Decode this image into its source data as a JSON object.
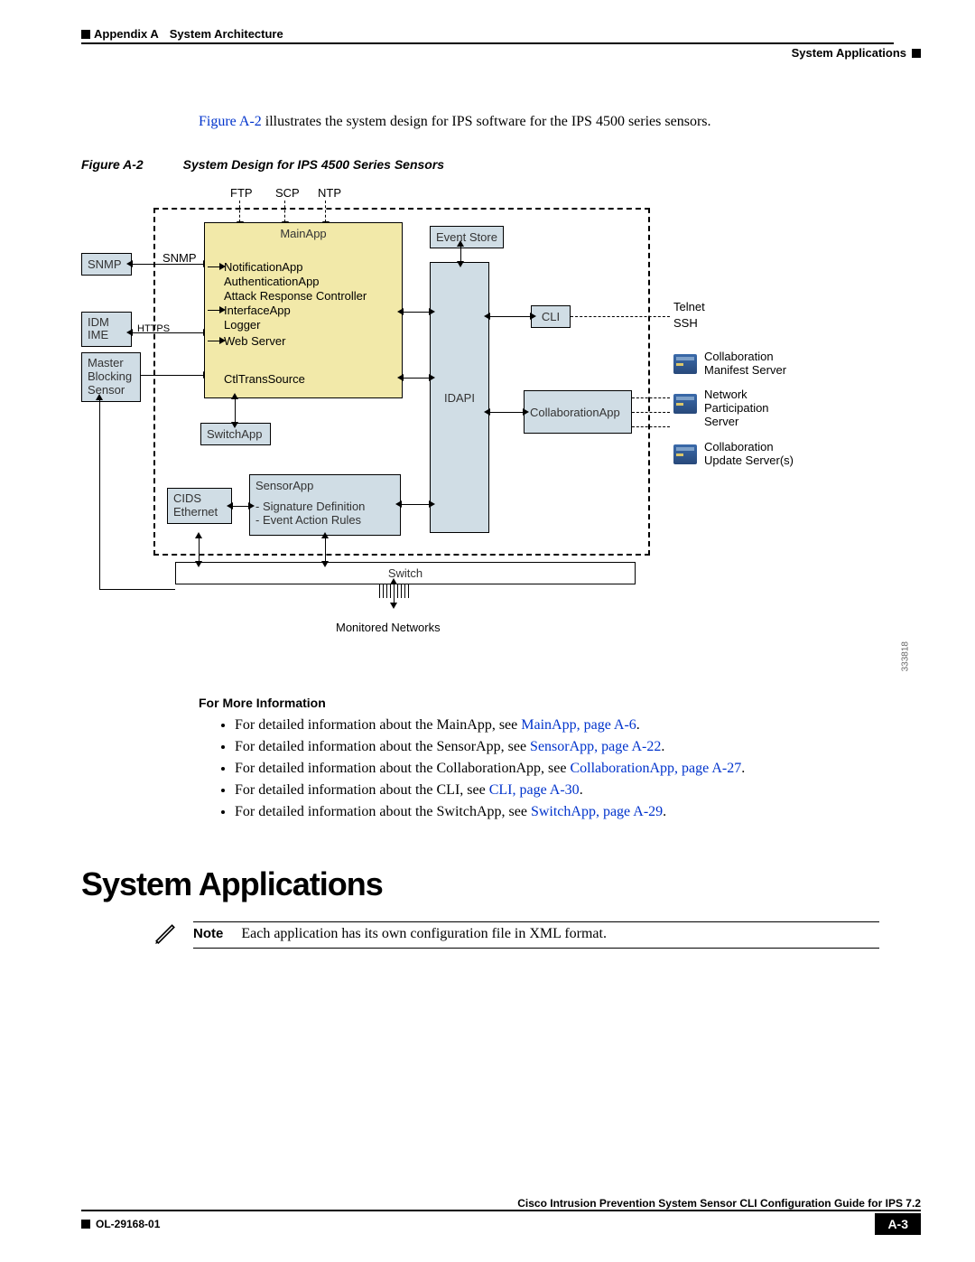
{
  "header": {
    "appendix": "Appendix A",
    "archTitle": "System Architecture",
    "rightTitle": "System Applications"
  },
  "intro": {
    "linkText": "Figure A-2",
    "rest": " illustrates the system design for IPS software for the IPS 4500 series sensors."
  },
  "figure": {
    "number": "Figure A-2",
    "caption": "System Design for IPS 4500 Series Sensors",
    "labels": {
      "ftp": "FTP",
      "scp": "SCP",
      "ntp": "NTP",
      "snmpOut": "SNMP",
      "snmpIn": "SNMP",
      "https": "HTTPS",
      "idm": "IDM",
      "ime": "IME",
      "master": "Master\nBlocking\nSensor",
      "mainapp": "MainApp",
      "notif": "NotificationApp",
      "auth": "AuthenticationApp",
      "arc": "Attack Response Controller",
      "iface": "InterfaceApp",
      "logger": "Logger",
      "web": "Web Server",
      "ctl": "CtlTransSource",
      "switchapp": "SwitchApp",
      "cids": "CIDS\nEthernet",
      "sensorapp": "SensorApp",
      "sigdef": "- Signature Definition",
      "ear": "- Event Action Rules",
      "idapi": "IDAPI",
      "eventstore": "Event Store",
      "cli": "CLI",
      "collabapp": "CollaborationApp",
      "telnet": "Telnet",
      "ssh": "SSH",
      "srv1": "Collaboration\nManifest Server",
      "srv2": "Network\nParticipation\nServer",
      "srv3": "Collaboration\nUpdate Server(s)",
      "switch": "Switch",
      "monnet": "Monitored Networks",
      "figid": "333818"
    }
  },
  "moreInfoHeader": "For More Information",
  "moreInfo": [
    {
      "pre": "For detailed information about the MainApp, see ",
      "link": "MainApp, page A-6",
      "post": "."
    },
    {
      "pre": "For detailed information about the SensorApp, see ",
      "link": "SensorApp, page A-22",
      "post": "."
    },
    {
      "pre": "For detailed information about the CollaborationApp, see ",
      "link": "CollaborationApp, page A-27",
      "post": "."
    },
    {
      "pre": "For detailed information about the CLI, see ",
      "link": "CLI, page A-30",
      "post": "."
    },
    {
      "pre": "For detailed information about the SwitchApp, see ",
      "link": "SwitchApp, page A-29",
      "post": "."
    }
  ],
  "sectionTitle": "System Applications",
  "note": {
    "label": "Note",
    "text": "Each application has its own configuration file in XML format."
  },
  "footer": {
    "book": "Cisco Intrusion Prevention System Sensor CLI Configuration Guide for IPS 7.2",
    "docnum": "OL-29168-01",
    "page": "A-3"
  }
}
